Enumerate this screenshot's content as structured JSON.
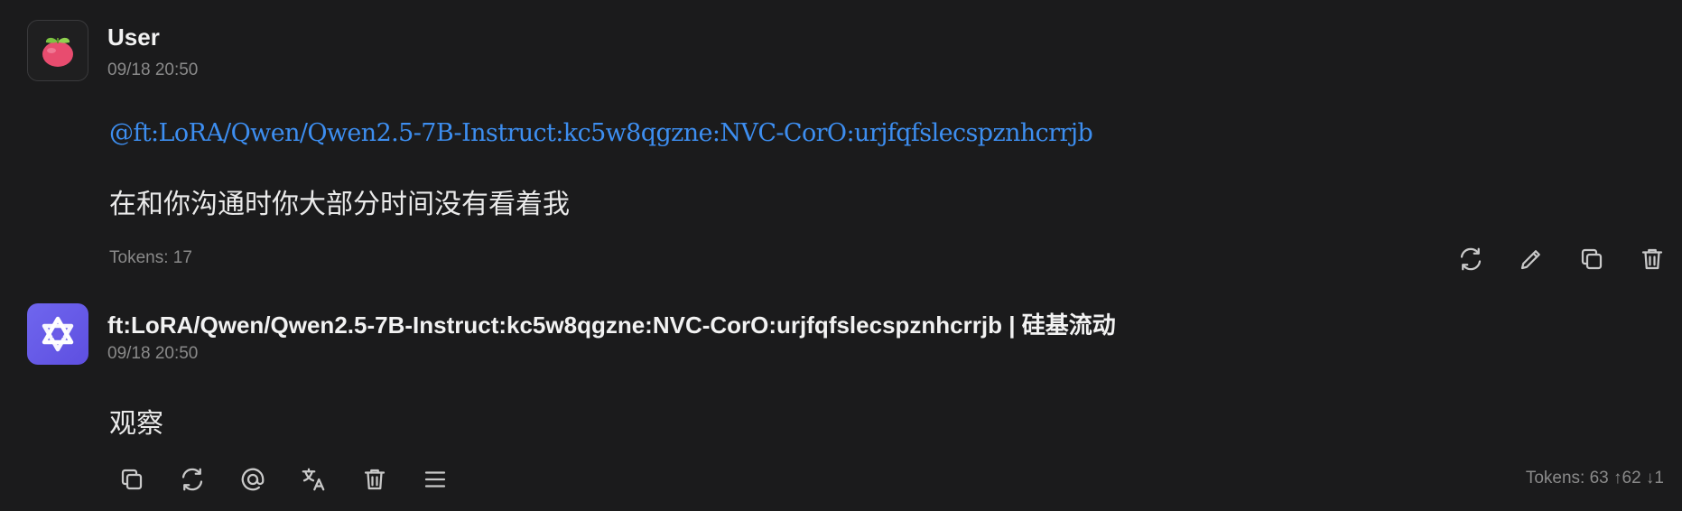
{
  "user_message": {
    "author": "User",
    "time": "09/18 20:50",
    "mention": "@ft:LoRA/Qwen/Qwen2.5-7B-Instruct:kc5w8qgzne:NVC-CorO:urjfqfslecspznhcrrjb",
    "text": "在和你沟通时你大部分时间没有看着我",
    "tokens": "Tokens: 17",
    "actions": [
      "regenerate-icon",
      "edit-icon",
      "copy-icon",
      "delete-icon"
    ]
  },
  "assistant_message": {
    "author": "ft:LoRA/Qwen/Qwen2.5-7B-Instruct:kc5w8qgzne:NVC-CorO:urjfqfslecspznhcrrjb | 硅基流动",
    "time": "09/18 20:50",
    "text": "观察",
    "tokens": "Tokens: 63 ↑62 ↓1",
    "actions": [
      "copy-icon",
      "regenerate-icon",
      "mention-icon",
      "translate-icon",
      "delete-icon",
      "more-menu-icon"
    ]
  },
  "colors": {
    "background": "#1b1b1c",
    "mention": "#3d8ef0",
    "model_avatar": "#6c5ce7",
    "muted_text": "#8a8a8a"
  }
}
